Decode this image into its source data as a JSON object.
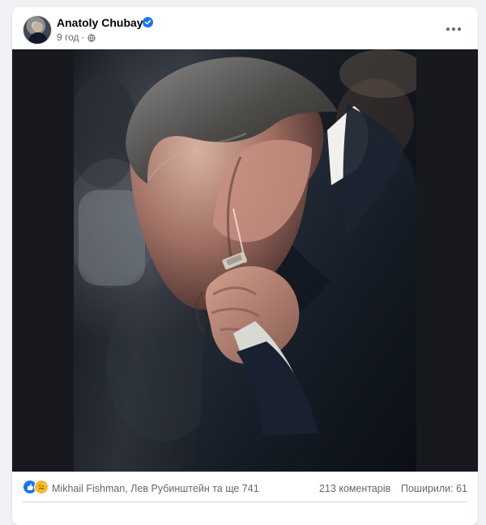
{
  "post": {
    "author": "Anatoly Chubays",
    "time": "9 год",
    "separator": "·",
    "reactions_text": "Mikhail Fishman, Лев Рубинштейн та ще 741",
    "comments_text": "213 коментарів",
    "shares_text": "Поширили: 61"
  },
  "icons": {
    "avatar": "profile-photo",
    "verified": "verified-badge-icon",
    "privacy": "globe-icon",
    "more": "more-horizontal-icon",
    "reaction_like": "like-reaction-icon",
    "reaction_care": "care-reaction-icon"
  },
  "colors": {
    "facebook_blue": "#1877f2",
    "page_bg": "#f0f2f5",
    "card_bg": "#ffffff",
    "secondary_text": "#65676b",
    "primary_text": "#050505"
  }
}
